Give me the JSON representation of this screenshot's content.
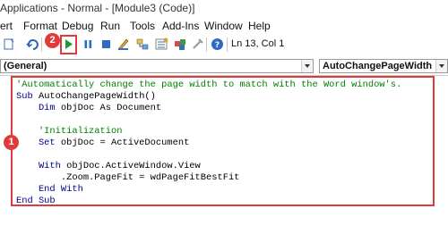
{
  "window": {
    "title": "Applications - Normal - [Module3 (Code)]"
  },
  "menu": {
    "items": [
      "ert",
      "Format",
      "Debug",
      "Run",
      "Tools",
      "Add-Ins",
      "Window",
      "Help"
    ]
  },
  "toolbar": {
    "position_readout": "Ln 13, Col 1",
    "buttons": [
      "insert-icon",
      "redo-icon",
      "run-icon",
      "break-icon",
      "reset-icon",
      "design-mode-icon",
      "project-explorer-icon",
      "properties-icon",
      "object-browser-icon",
      "toolbox-icon",
      "help-icon"
    ]
  },
  "selectors": {
    "object": "(General)",
    "procedure": "AutoChangePageWidth"
  },
  "annotations": {
    "step_code": "1",
    "step_run": "2",
    "highlight_color": "#e03b3b"
  },
  "code": {
    "lines": [
      {
        "kind": "comment",
        "text": "'Automatically change the page width to match with the Word window's."
      },
      {
        "kind": "code",
        "kw": "Sub ",
        "rest": "AutoChangePageWidth()"
      },
      {
        "kind": "code",
        "kw": "    Dim ",
        "rest": "objDoc As Document"
      },
      {
        "kind": "blank",
        "text": ""
      },
      {
        "kind": "comment",
        "text": "    'Initialization"
      },
      {
        "kind": "code",
        "kw": "    Set ",
        "rest": "objDoc = ActiveDocument"
      },
      {
        "kind": "blank",
        "text": ""
      },
      {
        "kind": "code",
        "kw": "    With ",
        "rest": "objDoc.ActiveWindow.View"
      },
      {
        "kind": "code",
        "kw": "",
        "rest": "        .Zoom.PageFit = wdPageFitBestFit"
      },
      {
        "kind": "code",
        "kw": "    End With",
        "rest": ""
      },
      {
        "kind": "code",
        "kw": "End Sub",
        "rest": ""
      }
    ]
  },
  "colors": {
    "keyword": "#00008b",
    "comment": "#008000",
    "accent_red": "#e03b3b"
  }
}
